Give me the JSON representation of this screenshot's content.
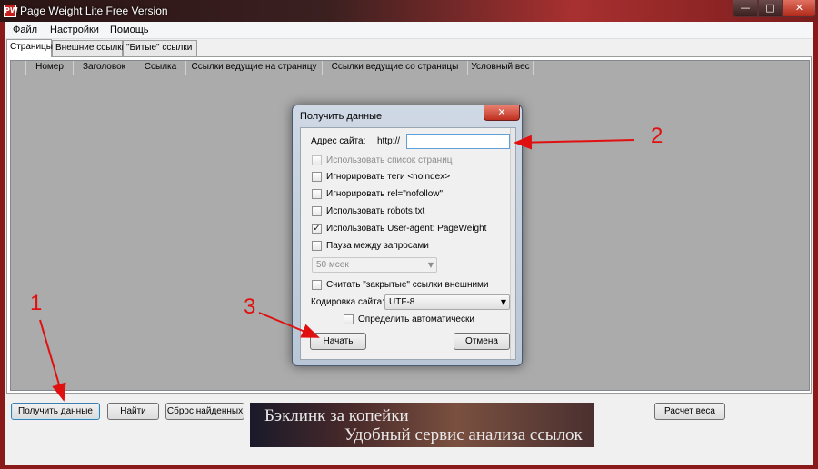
{
  "window": {
    "title": "Page Weight Lite Free Version",
    "app_icon": "PW",
    "min_glyph": "—",
    "max_glyph": "□",
    "close_glyph": "✕"
  },
  "menu": {
    "items": [
      "Файл",
      "Настройки",
      "Помощь"
    ]
  },
  "tabs": [
    "Страницы",
    "Внешние ссылки",
    "\"Битые\" ссылки"
  ],
  "grid": {
    "columns": [
      "Номер",
      "Заголовок",
      "Ссылка",
      "Ссылки ведущие на страницу",
      "Ссылки ведущие со страницы",
      "Условный вес"
    ]
  },
  "buttons": {
    "get_data": "Получить данные",
    "find": "Найти",
    "reset": "Сброс найденных",
    "calc": "Расчет веса"
  },
  "banner": {
    "line1": "Бэклинк за копейки",
    "line2": "Удобный сервис анализа ссылок"
  },
  "dialog": {
    "title": "Получить данные",
    "close_glyph": "✕",
    "address_label": "Адрес сайта:",
    "protocol": "http://",
    "url_value": "",
    "options": [
      {
        "label": "Использовать список страниц",
        "checked": false,
        "disabled": true
      },
      {
        "label": "Игнорировать теги <noindex>",
        "checked": false,
        "disabled": false
      },
      {
        "label": "Игнорировать rel=\"nofollow\"",
        "checked": false,
        "disabled": false
      },
      {
        "label": "Использовать robots.txt",
        "checked": false,
        "disabled": false
      },
      {
        "label": "Использовать User-agent: PageWeight",
        "checked": true,
        "disabled": false
      },
      {
        "label": "Пауза между запросами",
        "checked": false,
        "disabled": false
      }
    ],
    "pause_value": "50 мсек",
    "closed_links_label": "Считать \"закрытые\" ссылки внешними",
    "encoding_label": "Кодировка сайта:",
    "encoding_value": "UTF-8",
    "auto_detect_label": "Определить автоматически",
    "start_label": "Начать",
    "cancel_label": "Отмена",
    "check_glyph": "✓",
    "arrow_glyph": "▼"
  },
  "annotations": {
    "labels": [
      "1",
      "2",
      "3"
    ],
    "color": "#e01010"
  }
}
